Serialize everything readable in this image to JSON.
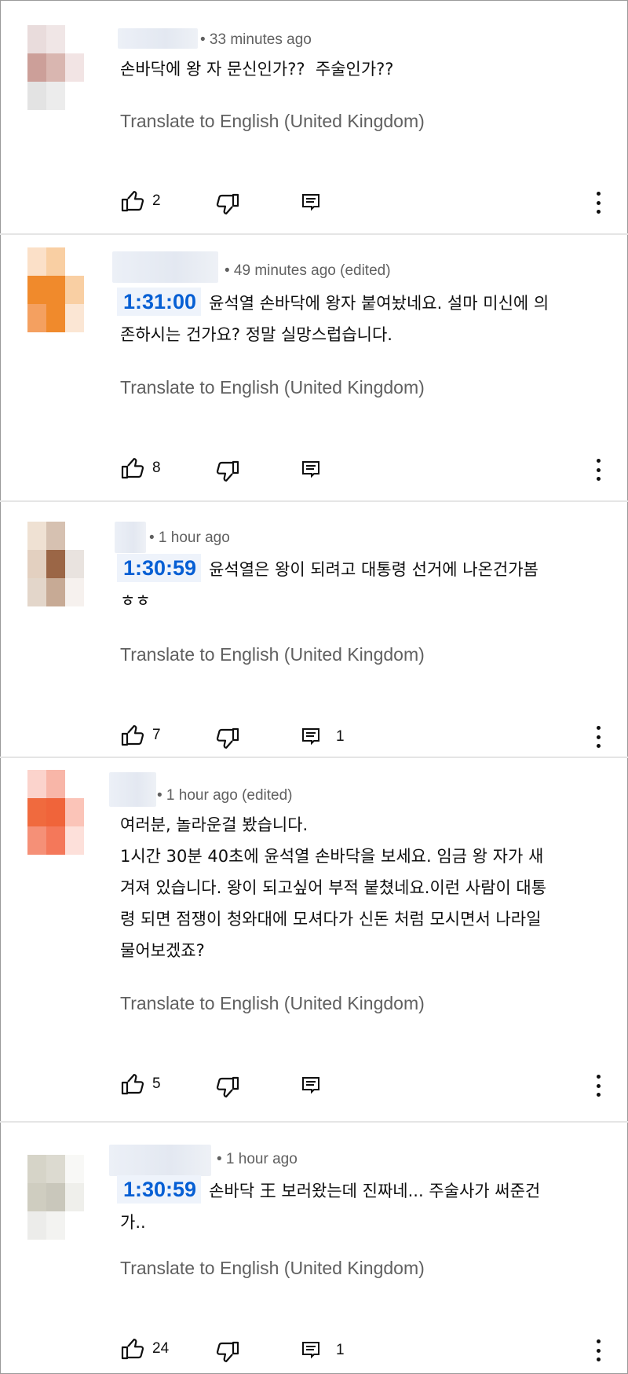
{
  "comments": [
    {
      "time": "• 33 minutes ago",
      "timestamp_link": "",
      "text": "손바닥에 왕 자 문신인가??  주술인가??",
      "translate": "Translate to English (United Kingdom)",
      "likes": "2",
      "replies": "",
      "avatar_colors": [
        "#e9dcdc",
        "#f0e6e6",
        "#ffffff",
        "#cc9f99",
        "#d9b6b0",
        "#f2e4e4",
        "#e3e3e3",
        "#ececec",
        "#ffffff"
      ]
    },
    {
      "time": "• 49 minutes ago (edited)",
      "timestamp_link": "1:31:00",
      "text": "윤석열 손바닥에 왕자 붙여놨네요. 설마 미신에 의\n존하시는 건가요? 정말 실망스럽습니다.",
      "translate": "Translate to English (United Kingdom)",
      "likes": "8",
      "replies": "",
      "avatar_colors": [
        "#fbe0c8",
        "#f9cfa3",
        "#ffffff",
        "#f08a2c",
        "#f08a2c",
        "#f9cfa3",
        "#f4a060",
        "#f08a2c",
        "#fbe6d4"
      ]
    },
    {
      "time": "• 1 hour ago",
      "timestamp_link": "1:30:59",
      "text": "윤석열은 왕이 되려고 대통령 선거에 나온건가봄\nㅎㅎ",
      "translate": "Translate to English (United Kingdom)",
      "likes": "7",
      "replies": "1",
      "avatar_colors": [
        "#efe1d3",
        "#d6c1b1",
        "#ffffff",
        "#e3d0c0",
        "#9b6646",
        "#e9e3df",
        "#e3d6ca",
        "#c7aa95",
        "#f6f1ee"
      ]
    },
    {
      "time": "• 1 hour ago (edited)",
      "timestamp_link": "",
      "text": "여러분, 놀라운걸 봤습니다.\n1시간 30분 40초에 윤석열 손바닥을 보세요. 임금 왕 자가 새\n겨져 있습니다. 왕이 되고싶어 부적 붙쳤네요.이런 사람이 대통\n령 되면 점쟁이 청와대에 모셔다가 신돈 처럼 모시면서 나라일\n물어보겠죠?",
      "translate": "Translate to English (United Kingdom)",
      "likes": "5",
      "replies": "",
      "avatar_colors": [
        "#fbd3cc",
        "#f8b6a8",
        "#ffffff",
        "#f06a3e",
        "#f0643a",
        "#fbc4b8",
        "#f59077",
        "#f4785a",
        "#fde0da"
      ]
    },
    {
      "time": "• 1 hour ago",
      "timestamp_link": "1:30:59",
      "text": "손바닥 王 보러왔는데 진짜네... 주술사가 써준건\n가..",
      "translate": "Translate to English (United Kingdom)",
      "likes": "24",
      "replies": "1",
      "avatar_colors": [
        "#d6d4c8",
        "#dcdad0",
        "#f8f8f6",
        "#cfcdc0",
        "#c9c7bb",
        "#efefeb",
        "#ececea",
        "#f3f3f1",
        "#ffffff"
      ]
    }
  ]
}
